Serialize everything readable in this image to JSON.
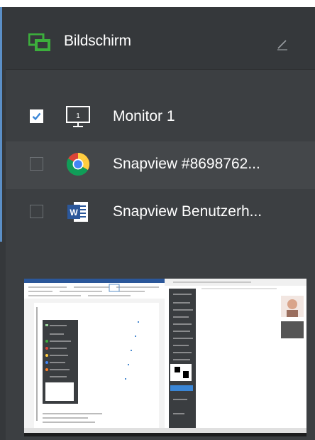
{
  "header": {
    "title": "Bildschirm",
    "icon": "screen-share-icon",
    "accent_color": "#3cae3c"
  },
  "sources": [
    {
      "label": "Monitor 1",
      "checked": true,
      "icon": "monitor-icon"
    },
    {
      "label": "Snapview #8698762...",
      "checked": false,
      "icon": "chrome-icon"
    },
    {
      "label": "Snapview Benutzerh...",
      "checked": false,
      "icon": "word-icon"
    }
  ],
  "preview": {
    "icon": "screen-preview-thumbnail"
  }
}
